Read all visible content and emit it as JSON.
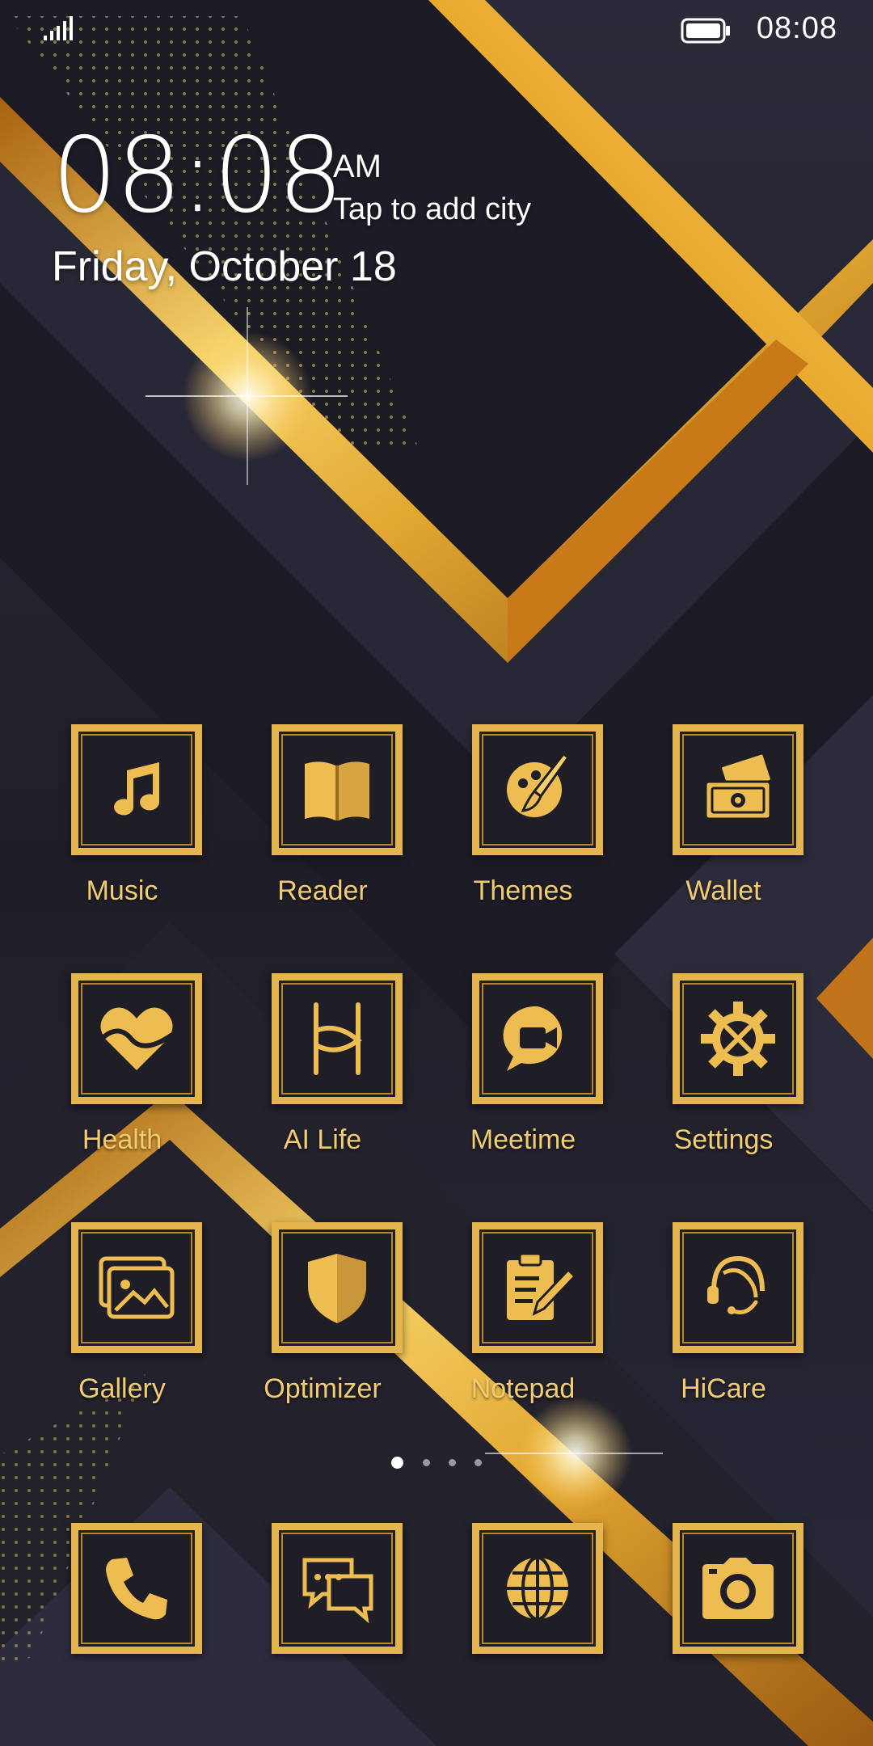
{
  "status_bar": {
    "time": "08:08",
    "signal_icon": "signal-icon",
    "battery_icon": "battery-icon"
  },
  "clock_widget": {
    "time": "08:08",
    "ampm": "AM",
    "city_prompt": "Tap to add city",
    "date": "Friday, October 18"
  },
  "apps": [
    {
      "label": "Music",
      "icon": "music-note-icon"
    },
    {
      "label": "Reader",
      "icon": "book-icon"
    },
    {
      "label": "Themes",
      "icon": "paintbrush-icon"
    },
    {
      "label": "Wallet",
      "icon": "wallet-icon"
    },
    {
      "label": "Health",
      "icon": "heart-icon"
    },
    {
      "label": "AI Life",
      "icon": "ai-life-icon"
    },
    {
      "label": "Meetime",
      "icon": "video-chat-icon"
    },
    {
      "label": "Settings",
      "icon": "gear-icon"
    },
    {
      "label": "Gallery",
      "icon": "gallery-icon"
    },
    {
      "label": "Optimizer",
      "icon": "shield-icon"
    },
    {
      "label": "Notepad",
      "icon": "notepad-icon"
    },
    {
      "label": "HiCare",
      "icon": "headset-icon"
    }
  ],
  "page_indicator": {
    "pages": 4,
    "current": 1
  },
  "dock": [
    {
      "icon": "phone-icon"
    },
    {
      "icon": "messages-icon"
    },
    {
      "icon": "browser-globe-icon"
    },
    {
      "icon": "camera-icon"
    }
  ],
  "colors": {
    "background": "#23222e",
    "gold": "#e3b54c",
    "gold_dark": "#b7791c",
    "label": "#f2cc71"
  }
}
